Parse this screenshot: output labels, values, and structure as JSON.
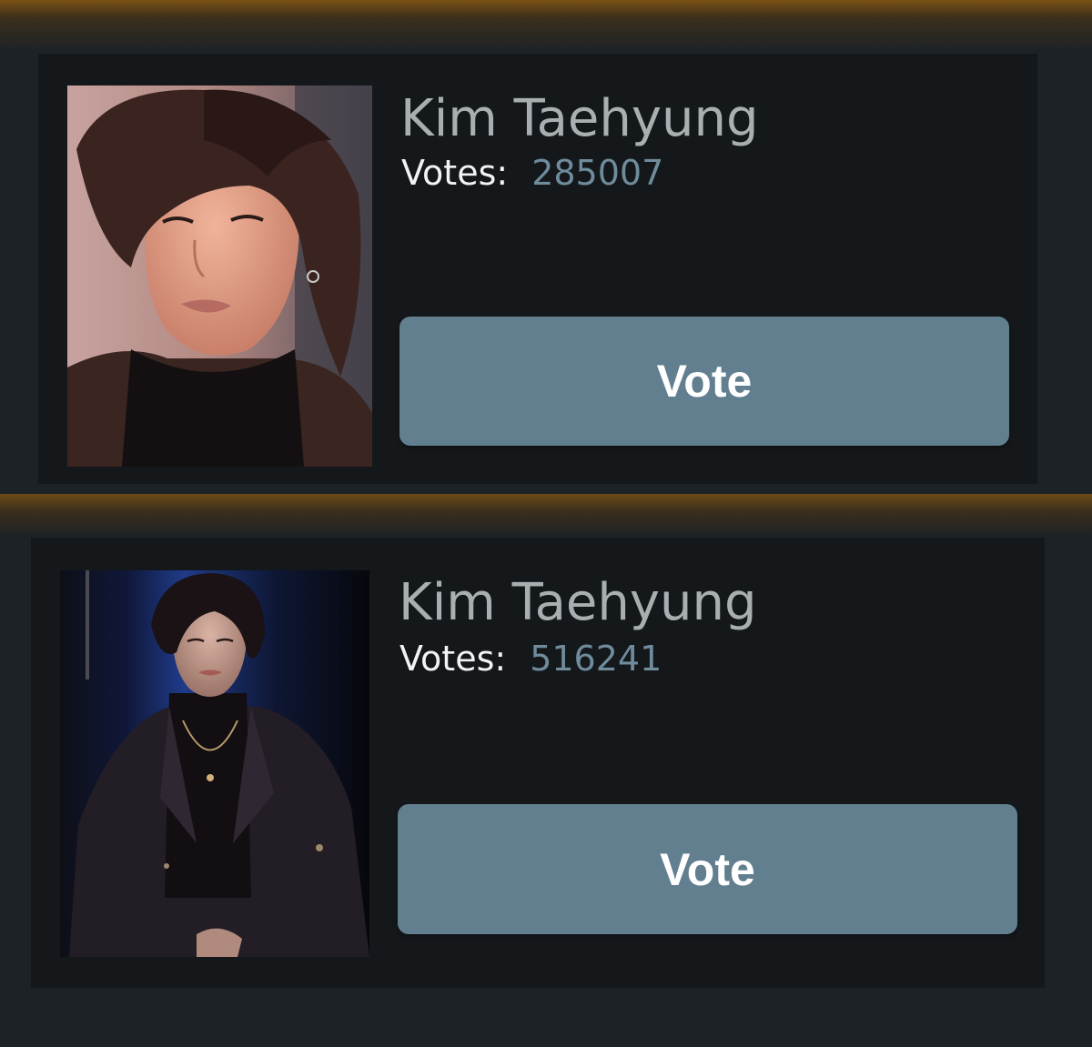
{
  "cards": [
    {
      "name": "Kim Taehyung",
      "votes_label": "Votes:",
      "votes_value": "285007",
      "vote_button_label": "Vote"
    },
    {
      "name": "Kim Taehyung",
      "votes_label": "Votes:",
      "votes_value": "516241",
      "vote_button_label": "Vote"
    }
  ],
  "colors": {
    "page_background": "#1d2226",
    "card_background": "#14181b",
    "name_text": "#a9aeb1",
    "votes_value_text": "#6f8b9c",
    "button_background": "#627f8f",
    "glow_accent": "#7a5214"
  }
}
